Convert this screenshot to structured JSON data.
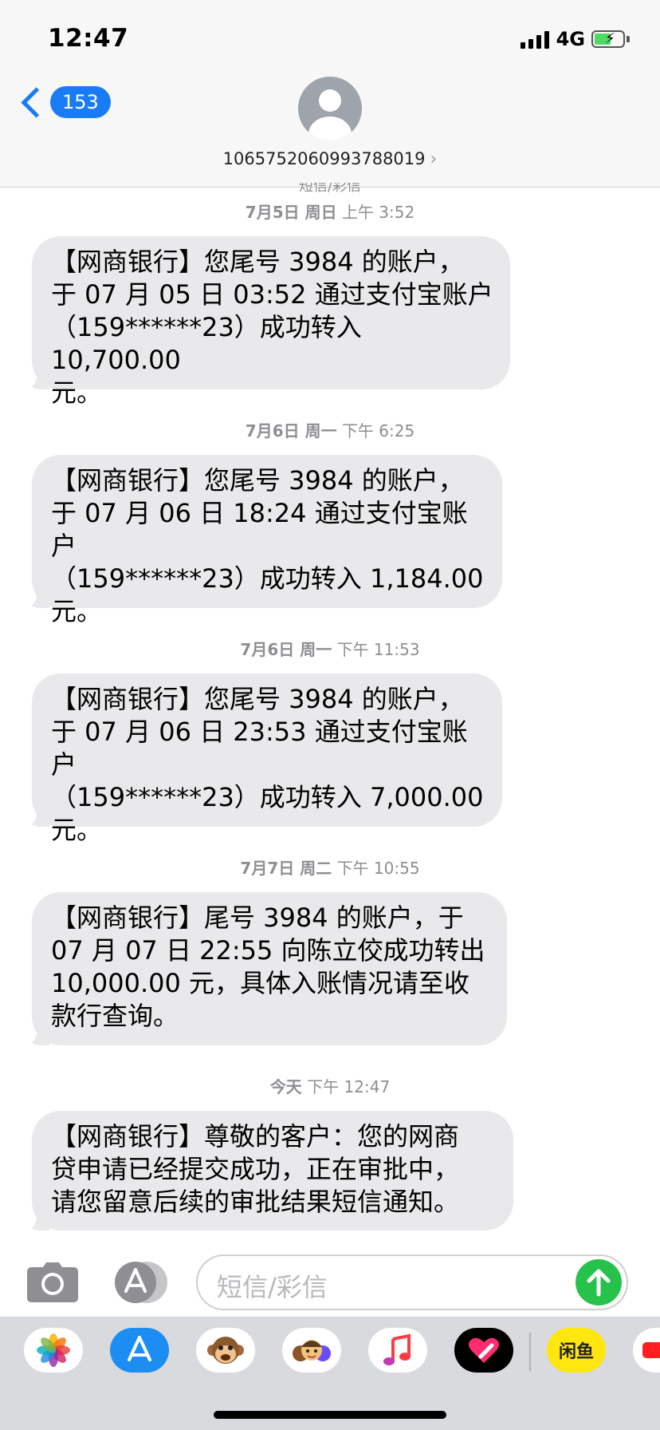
{
  "status_bar": {
    "time": "12:47",
    "network": "4G"
  },
  "header": {
    "back_count": "153",
    "contact_number": "1065752060993788019",
    "contact_chevron": "›"
  },
  "conversation": {
    "service_label_cut": "短信/彩信",
    "messages": [
      {
        "date": "7月5日 周日",
        "time": "上午 3:52",
        "text": "【网商银行】您尾号 3984 的账户，\n于 07 月 05 日 03:52 通过支付宝账户\n（159******23）成功转入 10,700.00\n元。"
      },
      {
        "date": "7月6日 周一",
        "time": "下午 6:25",
        "text": "【网商银行】您尾号 3984 的账户，\n于 07 月 06 日 18:24 通过支付宝账户\n（159******23）成功转入 1,184.00\n元。"
      },
      {
        "date": "7月6日 周一",
        "time": "下午 11:53",
        "text": "【网商银行】您尾号 3984 的账户，\n于 07 月 06 日 23:53 通过支付宝账户\n（159******23）成功转入 7,000.00\n元。"
      },
      {
        "date": "7月7日 周二",
        "time": "下午 10:55",
        "text": "【网商银行】尾号 3984 的账户，于\n07 月 07 日 22:55 向陈立佼成功转出\n10,000.00 元，具体入账情况请至收\n款行查询。"
      },
      {
        "date": "今天",
        "time": "下午 12:47",
        "text": "【网商银行】尊敬的客户：您的网商\n贷申请已经提交成功，正在审批中，\n请您留意后续的审批结果短信通知。"
      }
    ]
  },
  "input_bar": {
    "placeholder": "短信/彩信"
  },
  "app_drawer": {
    "apps": [
      {
        "name": "photos-app-icon"
      },
      {
        "name": "app-store-app-icon"
      },
      {
        "name": "animoji-app-icon"
      },
      {
        "name": "memoji-stickers-app-icon"
      },
      {
        "name": "music-app-icon"
      },
      {
        "name": "digital-touch-app-icon"
      },
      {
        "name": "xianyu-app-icon",
        "label": "闲鱼"
      },
      {
        "name": "partial-app-icon"
      }
    ]
  },
  "colors": {
    "ios_blue": "#1a7cf5",
    "bubble_gray": "#e9e9eb",
    "send_green": "#27c24c",
    "timestamp_gray": "#8e8e93"
  }
}
